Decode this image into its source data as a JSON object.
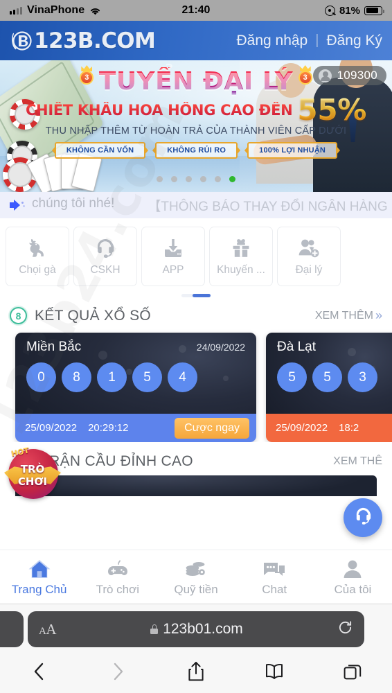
{
  "status_bar": {
    "carrier": "VinaPhone",
    "time": "21:40",
    "battery_percent": "81%",
    "signal_icon": "cellular-signal-icon",
    "wifi_icon": "wifi-icon",
    "orientation_lock_icon": "rotation-lock-icon",
    "battery_icon": "battery-icon"
  },
  "site_header": {
    "logo_text": "123B.COM",
    "login_label": "Đăng nhập",
    "separator": "|",
    "register_label": "Đăng Ký"
  },
  "banner": {
    "headline": "TUYỂN ĐẠI LÝ",
    "crown_number": "3",
    "subline": "CHIẾT KHẤU HOA HỒNG CAO ĐẾN",
    "percent": "55%",
    "tagline": "THU NHẬP THÊM TỪ HOÀN TRẢ CỦA THÀNH VIÊN CẤP DƯỚI",
    "pills": [
      "KHÔNG CẦN VỐN",
      "KHÔNG RỦI RO",
      "100% LỢI NHUẬN"
    ],
    "online_count": "109300",
    "online_icon": "user-icon",
    "dots_total": 6,
    "dots_active_index": 5,
    "active_dot_color": "#2fb82f"
  },
  "notice": {
    "speaker_icon": "speaker-icon",
    "text_1": "chúng tôi nhé!",
    "text_2": "【THÔNG BÁO THAY ĐỔI NGÂN HÀNG"
  },
  "quick_actions": {
    "items": [
      {
        "label": "Chọi gà",
        "icon": "rooster-icon"
      },
      {
        "label": "CSKH",
        "icon": "headset-support-icon"
      },
      {
        "label": "APP",
        "icon": "download-icon"
      },
      {
        "label": "Khuyến ...",
        "icon": "gift-icon"
      },
      {
        "label": "Đại lý",
        "icon": "add-user-icon"
      }
    ],
    "scroll_indicator": "page-2-of-2"
  },
  "lottery_section": {
    "badge_number": "8",
    "badge_color": "#3dbd9a",
    "title": "KẾT QUẢ XỔ SỐ",
    "more_label": "XEM THÊM",
    "more_icon": "double-chevron-right-icon",
    "cards": [
      {
        "region": "Miền Bắc",
        "draw_date": "24/09/2022",
        "numbers": [
          "0",
          "8",
          "1",
          "5",
          "4"
        ],
        "next_date": "25/09/2022",
        "next_time": "20:29:12",
        "bet_label": "Cược ngay",
        "footer_color": "#5d83ec"
      },
      {
        "region": "Đà Lạt",
        "draw_date": "",
        "numbers": [
          "5",
          "5",
          "3"
        ],
        "next_date": "25/09/2022",
        "next_time": "18:2",
        "bet_label": "",
        "footer_color": "#f2683f"
      }
    ]
  },
  "match_section": {
    "title": "TRẬN CẦU ĐỈNH CAO",
    "more_label": "XEM THÊ",
    "badge": {
      "hot": "HOT",
      "line1": "TRÒ",
      "line2": "CHƠI"
    }
  },
  "support_fab": {
    "icon": "headset-icon",
    "color": "#5d8bf0"
  },
  "app_nav": {
    "items": [
      {
        "label": "Trang Chủ",
        "icon": "home-icon",
        "active": true
      },
      {
        "label": "Trò chơi",
        "icon": "gamepad-icon",
        "active": false
      },
      {
        "label": "Quỹ tiền",
        "icon": "coins-icon",
        "active": false
      },
      {
        "label": "Chat",
        "icon": "chat-bubble-icon",
        "active": false
      },
      {
        "label": "Của tôi",
        "icon": "person-icon",
        "active": false
      }
    ],
    "active_color": "#4a79e0"
  },
  "browser": {
    "text_size_label": "AA",
    "lock_icon": "lock-icon",
    "url": "123b01.com",
    "reload_icon": "reload-icon",
    "toolbar": [
      {
        "icon": "back-chevron-icon",
        "enabled": true
      },
      {
        "icon": "forward-chevron-icon",
        "enabled": false
      },
      {
        "icon": "share-icon",
        "enabled": true
      },
      {
        "icon": "bookmarks-icon",
        "enabled": true
      },
      {
        "icon": "tabs-icon",
        "enabled": true
      }
    ]
  },
  "watermark": {
    "text": "123b24.com"
  }
}
